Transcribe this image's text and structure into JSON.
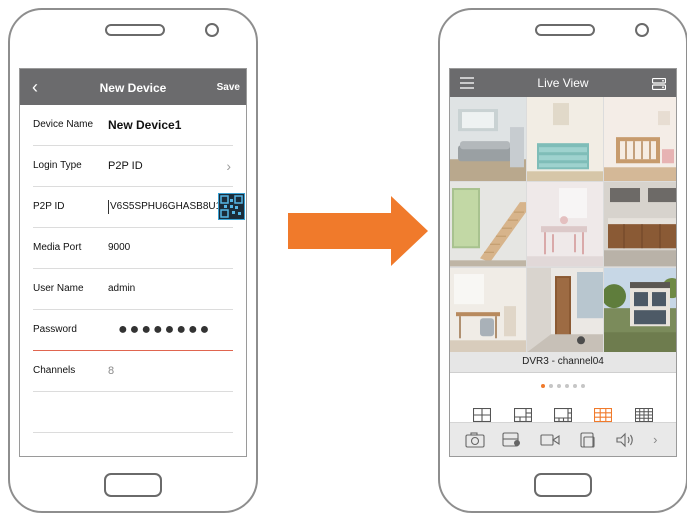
{
  "colors": {
    "topbar": "#6b6b6d",
    "accent": "#f07a2b",
    "arrow": "#f07a2b",
    "underline_active": "#e0654f"
  },
  "left_screen": {
    "topbar": {
      "back_icon": "back-chevron-icon",
      "title": "New Device",
      "save_label": "Save"
    },
    "fields": [
      {
        "label": "Device Name",
        "value": "New Device1"
      },
      {
        "label": "Login Type",
        "value": "P2P ID"
      },
      {
        "label": "P2P ID",
        "value": "V6S5SPHU6GHASB8U1"
      },
      {
        "label": "Media Port",
        "value": "9000"
      },
      {
        "label": "User Name",
        "value": "admin"
      },
      {
        "label": "Password",
        "value": "●●●●●●●●"
      },
      {
        "label": "Channels",
        "value": "8"
      }
    ]
  },
  "right_screen": {
    "topbar": {
      "menu_icon": "hamburger-menu-icon",
      "title": "Live View",
      "record_icon": "device-list-icon"
    },
    "channel_label": "DVR3 - channel04",
    "pager": {
      "pages": 6,
      "current": 1
    },
    "layouts": [
      "layout-4-icon",
      "layout-6-icon",
      "layout-8-icon",
      "layout-9-icon",
      "layout-16-icon"
    ],
    "selected_layout": 4,
    "toolbar": [
      "snapshot-icon",
      "record-icon",
      "video-clip-icon",
      "playback-icon",
      "audio-icon",
      "more-icon"
    ]
  }
}
